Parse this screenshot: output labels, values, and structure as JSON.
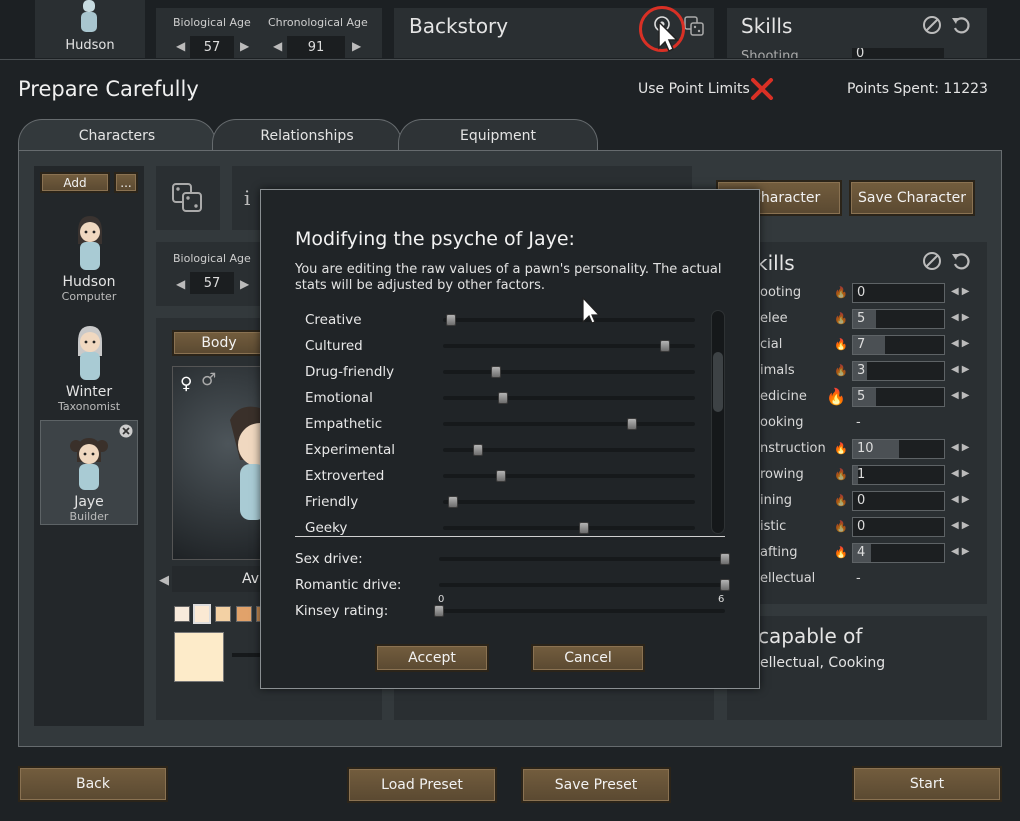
{
  "background_top": {
    "pawn_name": "Hudson",
    "bio_age_label": "Biological Age",
    "bio_age_value": "57",
    "chrono_age_label": "Chronological Age",
    "chrono_age_value": "91",
    "backstory_title": "Backstory",
    "skills_title": "Skills",
    "shooting_label": "Shooting",
    "shooting_value": "0"
  },
  "app": {
    "title": "Prepare Carefully",
    "point_limits_label": "Use Point Limits",
    "points_spent": "Points Spent: 11223"
  },
  "tabs": [
    {
      "label": "Characters"
    },
    {
      "label": "Relationships"
    },
    {
      "label": "Equipment"
    }
  ],
  "sidebar": {
    "add_label": "Add",
    "more_label": "...",
    "pawns": [
      {
        "name": "Hudson",
        "role": "Computer"
      },
      {
        "name": "Winter",
        "role": "Taxonomist"
      },
      {
        "name": "Jaye",
        "role": "Builder"
      }
    ]
  },
  "character": {
    "bio_age_label": "Biological Age",
    "bio_age_value": "57",
    "body_label": "Body",
    "avatar_label": "Av",
    "load_character_label": "d Character",
    "save_character_label": "Save Character"
  },
  "skills": {
    "title": "kills",
    "rows": [
      {
        "label": "ooting",
        "value": "0",
        "passion": "",
        "fill": 0
      },
      {
        "label": "elee",
        "value": "5",
        "passion": "",
        "fill": 0.25
      },
      {
        "label": "cial",
        "value": "7",
        "passion": "minor",
        "fill": 0.35
      },
      {
        "label": "imals",
        "value": "3",
        "passion": "",
        "fill": 0.15
      },
      {
        "label": "edicine",
        "value": "5",
        "passion": "major",
        "fill": 0.25
      },
      {
        "label": "ooking",
        "value": "-",
        "passion": "",
        "fill": 0
      },
      {
        "label": "nstruction",
        "value": "10",
        "passion": "minor",
        "fill": 0.5
      },
      {
        "label": "rowing",
        "value": "1",
        "passion": "",
        "fill": 0.05
      },
      {
        "label": "ining",
        "value": "0",
        "passion": "",
        "fill": 0
      },
      {
        "label": "istic",
        "value": "0",
        "passion": "",
        "fill": 0
      },
      {
        "label": "afting",
        "value": "4",
        "passion": "minor",
        "fill": 0.2
      },
      {
        "label": "ellectual",
        "value": "-",
        "passion": "",
        "fill": 0
      }
    ],
    "incapable_title": "capable of",
    "incapable_text": "ellectual, Cooking"
  },
  "dialog": {
    "title": "Modifying the psyche of Jaye:",
    "description": "You are editing the raw values of a pawn's personality. The actual stats will be adjusted by other factors.",
    "traits": [
      {
        "name": "Creative",
        "value": 0.03
      },
      {
        "name": "Cultured",
        "value": 0.88
      },
      {
        "name": "Drug-friendly",
        "value": 0.21
      },
      {
        "name": "Emotional",
        "value": 0.24
      },
      {
        "name": "Empathetic",
        "value": 0.75
      },
      {
        "name": "Experimental",
        "value": 0.14
      },
      {
        "name": "Extroverted",
        "value": 0.23
      },
      {
        "name": "Friendly",
        "value": 0.04
      },
      {
        "name": "Geeky",
        "value": 0.56
      }
    ],
    "sex_drive_label": "Sex drive:",
    "sex_drive_value": 1.0,
    "romantic_drive_label": "Romantic drive:",
    "romantic_drive_value": 1.0,
    "kinsey_label": "Kinsey rating:",
    "kinsey_min": "0",
    "kinsey_max": "6",
    "kinsey_value": 0,
    "accept_label": "Accept",
    "cancel_label": "Cancel"
  },
  "footer": {
    "back_label": "Back",
    "load_preset_label": "Load Preset",
    "save_preset_label": "Save Preset",
    "start_label": "Start"
  },
  "colors": {
    "accent_red": "#d93025",
    "button_brown": "#6a5538",
    "passion_flame": "#f0a020"
  }
}
